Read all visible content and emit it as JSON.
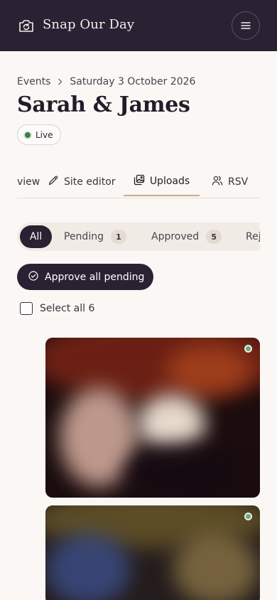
{
  "header": {
    "brand_title": "Snap Our Day",
    "brand_icon": "camera-refresh-icon",
    "menu_icon": "hamburger-menu-icon"
  },
  "breadcrumb": {
    "parent": "Events",
    "current": "Saturday 3 October 2026"
  },
  "event": {
    "title": "Sarah & James",
    "status": "Live"
  },
  "tabs": [
    {
      "label": "Overview",
      "visible_text": "view",
      "icon": ""
    },
    {
      "label": "Site editor",
      "icon": "pencil-icon"
    },
    {
      "label": "Uploads",
      "icon": "gallery-icon",
      "active": true
    },
    {
      "label": "RSVP",
      "visible_text": "RSV",
      "icon": "users-icon"
    }
  ],
  "filters": [
    {
      "label": "All",
      "selected": true
    },
    {
      "label": "Pending",
      "count": "1"
    },
    {
      "label": "Approved",
      "count": "5"
    },
    {
      "label": "Rej"
    }
  ],
  "actions": {
    "approve_all": "Approve all pending",
    "select_all": "Select all 6"
  },
  "colors": {
    "header_bg": "#2a2233",
    "page_bg": "#faf7f4",
    "live_dot": "#3f7a52",
    "active_tab_underline": "#c9a98a",
    "approved_dot": "#6da77a"
  }
}
